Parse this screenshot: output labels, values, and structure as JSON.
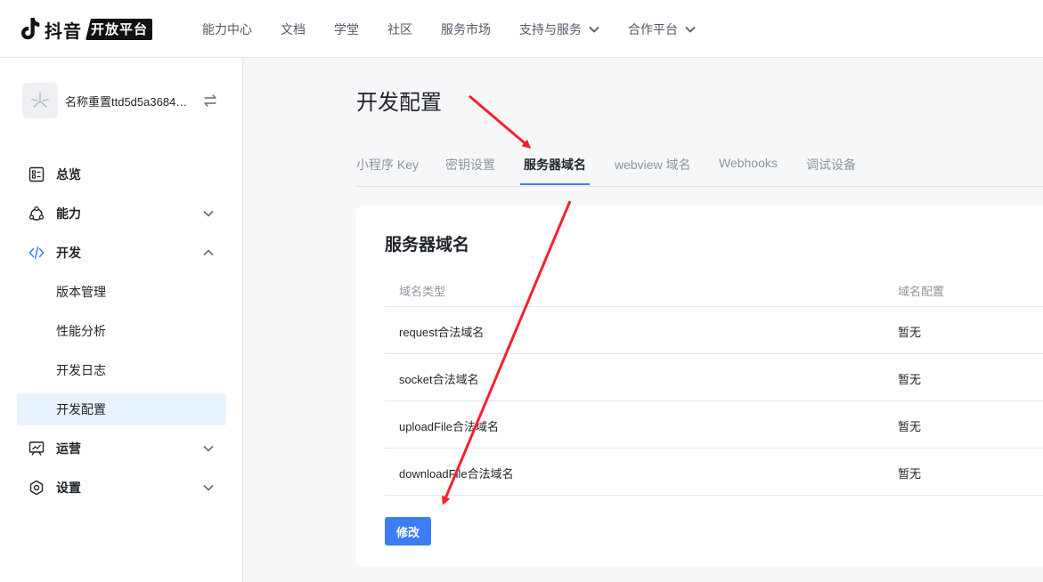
{
  "brand": {
    "name": "抖音",
    "badge": "开放平台"
  },
  "topnav": [
    {
      "label": "能力中心"
    },
    {
      "label": "文档"
    },
    {
      "label": "学堂"
    },
    {
      "label": "社区"
    },
    {
      "label": "服务市场"
    },
    {
      "label": "支持与服务",
      "dropdown": true
    },
    {
      "label": "合作平台",
      "dropdown": true
    }
  ],
  "app": {
    "name": "名称重置ttd5d5a3684a..."
  },
  "sidebar": {
    "items": [
      {
        "label": "总览",
        "icon": "dashboard-icon"
      },
      {
        "label": "能力",
        "icon": "capability-icon",
        "expanded": false
      },
      {
        "label": "开发",
        "icon": "code-icon",
        "expanded": true,
        "children": [
          {
            "label": "版本管理"
          },
          {
            "label": "性能分析"
          },
          {
            "label": "开发日志"
          },
          {
            "label": "开发配置",
            "active": true
          }
        ]
      },
      {
        "label": "运营",
        "icon": "operation-icon",
        "expanded": false
      },
      {
        "label": "设置",
        "icon": "settings-icon",
        "expanded": false
      }
    ]
  },
  "main": {
    "title": "开发配置",
    "tabs": [
      {
        "label": "小程序 Key"
      },
      {
        "label": "密钥设置"
      },
      {
        "label": "服务器域名",
        "active": true
      },
      {
        "label": "webview 域名"
      },
      {
        "label": "Webhooks"
      },
      {
        "label": "调试设备"
      }
    ],
    "card": {
      "title": "服务器域名",
      "columns": [
        "域名类型",
        "域名配置"
      ],
      "rows": [
        {
          "type": "request合法域名",
          "config": "暂无"
        },
        {
          "type": "socket合法域名",
          "config": "暂无"
        },
        {
          "type": "uploadFile合法域名",
          "config": "暂无"
        },
        {
          "type": "downloadFile合法域名",
          "config": "暂无"
        }
      ],
      "edit_label": "修改"
    }
  },
  "colors": {
    "accent": "#3c7cf5",
    "annotation": "#f5222d",
    "active_bg": "#e9f3ff"
  }
}
